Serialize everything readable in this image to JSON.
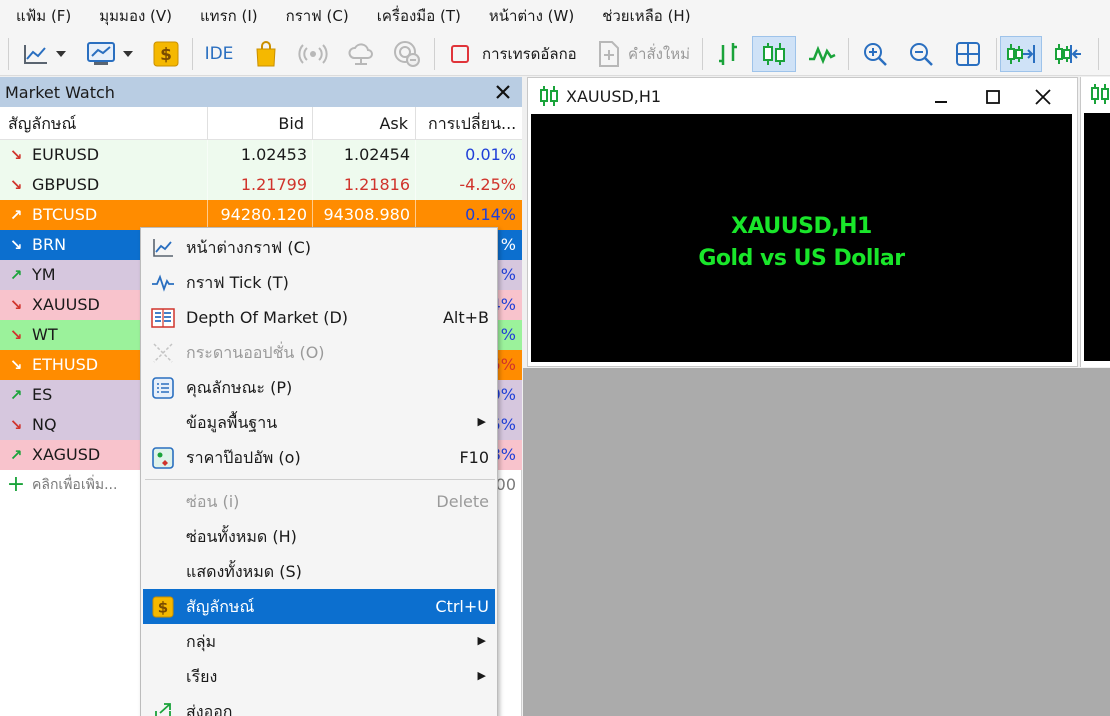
{
  "menu": [
    "แฟ้ม (F)",
    "มุมมอง (V)",
    "แทรก (I)",
    "กราฟ (C)",
    "เครื่องมือ (T)",
    "หน้าต่าง (W)",
    "ช่วยเหลือ (H)"
  ],
  "toolbar": {
    "ide_label": "IDE",
    "algo_label": "การเทรดอัลกอ",
    "new_order_label": "คำสั่งใหม่"
  },
  "market_watch": {
    "title": "Market Watch",
    "columns": {
      "symbol": "สัญลักษณ์",
      "bid": "Bid",
      "ask": "Ask",
      "change": "การเปลี่ยน..."
    },
    "rows": [
      {
        "symbol": "EURUSD",
        "bid": "1.02453",
        "ask": "1.02454",
        "change": "0.01%",
        "direction": "down",
        "bg": "#eefaee",
        "bid_color": "#1a1a1a",
        "ask_color": "#1a1a1a",
        "change_color": "#1f3fd8"
      },
      {
        "symbol": "GBPUSD",
        "bid": "1.21799",
        "ask": "1.21816",
        "change": "-4.25%",
        "direction": "down",
        "bg": "#eefaee",
        "bid_color": "#d0342c",
        "ask_color": "#d0342c",
        "change_color": "#d0342c"
      },
      {
        "symbol": "BTCUSD",
        "bid": "94280.120",
        "ask": "94308.980",
        "change": "0.14%",
        "direction": "up",
        "bg": "#ff8c00",
        "bid_color": "#ffffff",
        "ask_color": "#ffffff",
        "change_color": "#1f3fd8"
      },
      {
        "symbol": "BRN",
        "bid": "",
        "ask": "",
        "change": "%",
        "direction": "down",
        "bg": "#0c6fcf",
        "bid_color": "#ffffff",
        "ask_color": "#ffffff",
        "change_color": "#ffffff"
      },
      {
        "symbol": "YM",
        "bid": "",
        "ask": "",
        "change": "%",
        "direction": "up",
        "bg": "#d6c7de",
        "bid_color": "#1a1a1a",
        "ask_color": "#1a1a1a",
        "change_color": "#1f3fd8"
      },
      {
        "symbol": "XAUUSD",
        "bid": "",
        "ask": "",
        "change": "4%",
        "direction": "down",
        "bg": "#f8c3cc",
        "bid_color": "#1a1a1a",
        "ask_color": "#1a1a1a",
        "change_color": "#1f3fd8"
      },
      {
        "symbol": "WT",
        "bid": "",
        "ask": "",
        "change": "%",
        "direction": "down",
        "bg": "#9bf29b",
        "bid_color": "#1a1a1a",
        "ask_color": "#1a1a1a",
        "change_color": "#1f3fd8"
      },
      {
        "symbol": "ETHUSD",
        "bid": "",
        "ask": "",
        "change": "5%",
        "direction": "down",
        "bg": "#ff8c00",
        "bid_color": "#ffffff",
        "ask_color": "#ffffff",
        "change_color": "#d0342c"
      },
      {
        "symbol": "ES",
        "bid": "",
        "ask": "",
        "change": "9%",
        "direction": "up",
        "bg": "#d6c7de",
        "bid_color": "#1a1a1a",
        "ask_color": "#1a1a1a",
        "change_color": "#1f3fd8"
      },
      {
        "symbol": "NQ",
        "bid": "",
        "ask": "",
        "change": "5%",
        "direction": "down",
        "bg": "#d6c7de",
        "bid_color": "#1a1a1a",
        "ask_color": "#1a1a1a",
        "change_color": "#1f3fd8"
      },
      {
        "symbol": "XAGUSD",
        "bid": "",
        "ask": "",
        "change": "8%",
        "direction": "up",
        "bg": "#f8c3cc",
        "bid_color": "#1a1a1a",
        "ask_color": "#1a1a1a",
        "change_color": "#1f3fd8"
      }
    ],
    "add_row": {
      "label": "คลิกเพื่อเพิ่ม...",
      "value": "00"
    }
  },
  "chart": {
    "tab_title": "XAUUSD,H1",
    "overlay_line1": "XAUUSD,H1",
    "overlay_line2": "Gold vs US Dollar"
  },
  "context_menu": {
    "items": [
      {
        "label": "หน้าต่างกราฟ (C)",
        "shortcut": "",
        "icon": "line-chart-icon",
        "disabled": false,
        "submenu": false,
        "selected": false
      },
      {
        "label": "กราฟ Tick (T)",
        "shortcut": "",
        "icon": "tick-chart-icon",
        "disabled": false,
        "submenu": false,
        "selected": false
      },
      {
        "label": "Depth Of Market (D)",
        "shortcut": "Alt+B",
        "icon": "depth-of-market-icon",
        "disabled": false,
        "submenu": false,
        "selected": false
      },
      {
        "label": "กระดานออปชั่น (O)",
        "shortcut": "",
        "icon": "options-board-icon",
        "disabled": true,
        "submenu": false,
        "selected": false
      },
      {
        "label": "คุณลักษณะ (P)",
        "shortcut": "",
        "icon": "specification-icon",
        "disabled": false,
        "submenu": false,
        "selected": false
      },
      {
        "label": "ข้อมูลพื้นฐาน",
        "shortcut": "",
        "icon": "",
        "disabled": false,
        "submenu": true,
        "selected": false
      },
      {
        "label": "ราคาป๊อปอัพ (o)",
        "shortcut": "F10",
        "icon": "popup-prices-icon",
        "disabled": false,
        "submenu": false,
        "selected": false
      },
      {
        "label": "ซ่อน (i)",
        "shortcut": "Delete",
        "icon": "",
        "disabled": true,
        "submenu": false,
        "selected": false
      },
      {
        "label": "ซ่อนทั้งหมด (H)",
        "shortcut": "",
        "icon": "",
        "disabled": false,
        "submenu": false,
        "selected": false
      },
      {
        "label": "แสดงทั้งหมด (S)",
        "shortcut": "",
        "icon": "",
        "disabled": false,
        "submenu": false,
        "selected": false
      },
      {
        "label": "สัญลักษณ์",
        "shortcut": "Ctrl+U",
        "icon": "dollar-icon",
        "disabled": false,
        "submenu": false,
        "selected": true
      },
      {
        "label": "กลุ่ม",
        "shortcut": "",
        "icon": "",
        "disabled": false,
        "submenu": true,
        "selected": false
      },
      {
        "label": "เรียง",
        "shortcut": "",
        "icon": "",
        "disabled": false,
        "submenu": true,
        "selected": false
      },
      {
        "label": "ส่งออก",
        "shortcut": "",
        "icon": "export-icon",
        "disabled": false,
        "submenu": false,
        "selected": false
      }
    ]
  }
}
